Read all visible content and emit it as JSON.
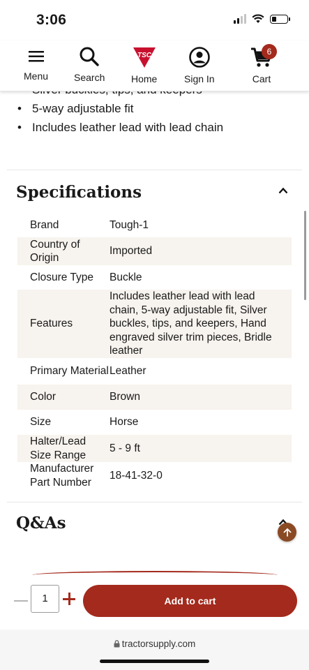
{
  "status": {
    "time": "3:06"
  },
  "nav": {
    "menu": "Menu",
    "search": "Search",
    "home": "Home",
    "sign_in": "Sign In",
    "cart": "Cart",
    "cart_count": "6",
    "logo_text": "TSC"
  },
  "features": [
    "Silver buckles, tips, and keepers",
    "5-way adjustable fit",
    "Includes leather lead with lead chain"
  ],
  "specifications": {
    "title": "Specifications",
    "rows": [
      {
        "label": "Brand",
        "value": "Tough-1"
      },
      {
        "label": "Country of Origin",
        "value": "Imported"
      },
      {
        "label": "Closure Type",
        "value": "Buckle"
      },
      {
        "label": "Features",
        "value": "Includes leather lead with lead chain, 5-way adjustable fit, Silver buckles, tips, and keepers, Hand engraved silver trim pieces, Bridle leather"
      },
      {
        "label": "Primary Material",
        "value": "Leather"
      },
      {
        "label": "Color",
        "value": "Brown"
      },
      {
        "label": "Size",
        "value": "Horse"
      },
      {
        "label": "Halter/Lead Size Range",
        "value": "5 - 9 ft"
      },
      {
        "label": "Manufacturer Part Number",
        "value": "18-41-32-0"
      }
    ]
  },
  "qa": {
    "title": "Q&As"
  },
  "purchase": {
    "quantity": "1",
    "add_to_cart": "Add to cart"
  },
  "browser": {
    "url": "tractorsupply.com"
  },
  "colors": {
    "brand_red": "#a32a1c",
    "row_alt": "#f7f3ee",
    "fab_brown": "#8a4a24"
  }
}
